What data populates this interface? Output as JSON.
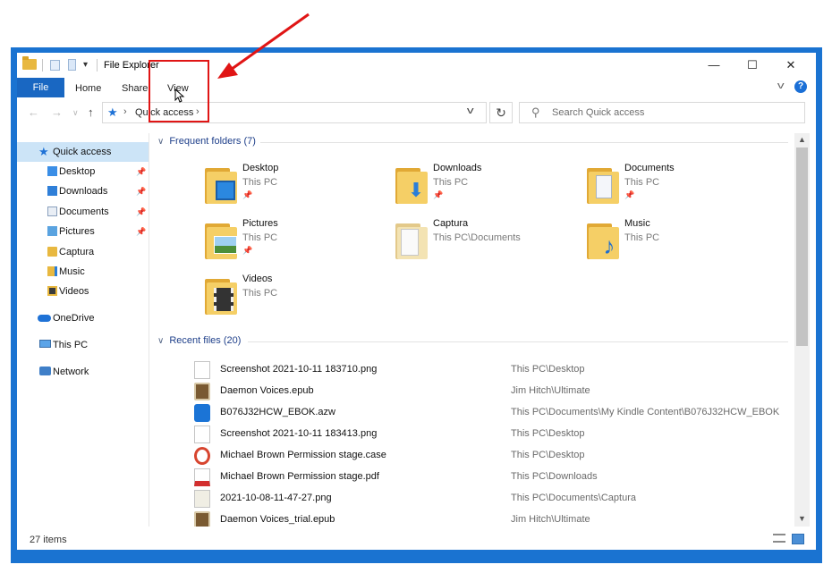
{
  "window": {
    "title": "File Explorer",
    "minimize_glyph": "—",
    "maximize_glyph": "☐",
    "close_glyph": "✕"
  },
  "ribbon": {
    "tabs": [
      {
        "label": "File"
      },
      {
        "label": "Home"
      },
      {
        "label": "Share"
      },
      {
        "label": "View"
      }
    ],
    "help_glyph": "?"
  },
  "address": {
    "location": "Quick access",
    "search_placeholder": "Search Quick access"
  },
  "nav_pane": {
    "quick_access": "Quick access",
    "items": [
      {
        "label": "Desktop",
        "pinned": true,
        "icon": "desktop-folder-icon"
      },
      {
        "label": "Downloads",
        "pinned": true,
        "icon": "downloads-folder-icon"
      },
      {
        "label": "Documents",
        "pinned": true,
        "icon": "documents-folder-icon"
      },
      {
        "label": "Pictures",
        "pinned": true,
        "icon": "pictures-folder-icon"
      },
      {
        "label": "Captura",
        "pinned": false,
        "icon": "folder-icon"
      },
      {
        "label": "Music",
        "pinned": false,
        "icon": "music-folder-icon"
      },
      {
        "label": "Videos",
        "pinned": false,
        "icon": "videos-folder-icon"
      }
    ],
    "onedrive": "OneDrive",
    "this_pc": "This PC",
    "network": "Network"
  },
  "frequent": {
    "header": "Frequent folders (7)",
    "folders": [
      {
        "name": "Desktop",
        "location": "This PC",
        "pinned": true
      },
      {
        "name": "Downloads",
        "location": "This PC",
        "pinned": true
      },
      {
        "name": "Documents",
        "location": "This PC",
        "pinned": true
      },
      {
        "name": "Pictures",
        "location": "This PC",
        "pinned": true
      },
      {
        "name": "Captura",
        "location": "This PC\\Documents",
        "pinned": false
      },
      {
        "name": "Music",
        "location": "This PC",
        "pinned": false
      },
      {
        "name": "Videos",
        "location": "This PC",
        "pinned": false
      }
    ]
  },
  "recent": {
    "header": "Recent files (20)",
    "files": [
      {
        "name": "Screenshot 2021-10-11 183710.png",
        "path": "This PC\\Desktop",
        "icon": "png-file-icon"
      },
      {
        "name": "Daemon Voices.epub",
        "path": "Jim Hitch\\Ultimate",
        "icon": "epub-file-icon"
      },
      {
        "name": "B076J32HCW_EBOK.azw",
        "path": "This PC\\Documents\\My Kindle Content\\B076J32HCW_EBOK",
        "icon": "azw-file-icon"
      },
      {
        "name": "Screenshot 2021-10-11 183413.png",
        "path": "This PC\\Desktop",
        "icon": "png-file-icon"
      },
      {
        "name": "Michael Brown Permission stage.case",
        "path": "This PC\\Desktop",
        "icon": "case-file-icon"
      },
      {
        "name": "Michael Brown Permission stage.pdf",
        "path": "This PC\\Downloads",
        "icon": "pdf-file-icon"
      },
      {
        "name": "2021-10-08-11-47-27.png",
        "path": "This PC\\Documents\\Captura",
        "icon": "png-file-icon"
      },
      {
        "name": "Daemon Voices_trial.epub",
        "path": "Jim Hitch\\Ultimate",
        "icon": "epub-file-icon"
      }
    ]
  },
  "status": {
    "item_count": "27 items"
  },
  "colors": {
    "accent": "#1967c2",
    "frame": "#1a73d1",
    "annotation": "#e01515",
    "folder": "#f5cf66"
  }
}
